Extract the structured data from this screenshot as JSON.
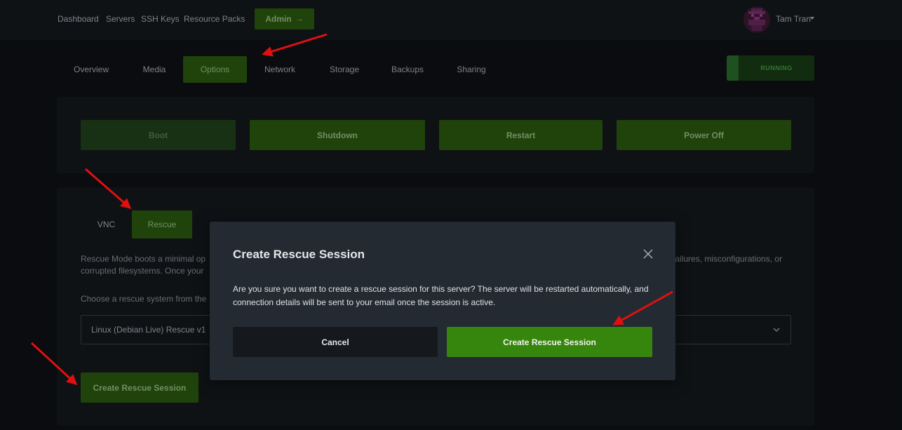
{
  "nav": {
    "dashboard": "Dashboard",
    "servers": "Servers",
    "ssh_keys": "SSH Keys",
    "resource_packs": "Resource Packs",
    "admin": "Admin",
    "admin_arrow": "→"
  },
  "user": {
    "name": "Tam Tran"
  },
  "tabs": [
    "Overview",
    "Media",
    "Options",
    "Network",
    "Storage",
    "Backups",
    "Sharing"
  ],
  "active_tab": "Options",
  "status": {
    "label": "RUNNING",
    "color": "#2a6b2b"
  },
  "power": {
    "boot": "Boot",
    "shutdown": "Shutdown",
    "restart": "Restart",
    "power_off": "Power Off"
  },
  "subtabs": {
    "vnc": "VNC",
    "rescue": "Rescue"
  },
  "rescue": {
    "desc_line1_left": "Rescue Mode boots a minimal op",
    "desc_line1_right": "failures, misconfigurations, or",
    "desc_line2": "corrupted filesystems. Once your",
    "choose_text": "Choose a rescue system from the",
    "selected_system": "Linux (Debian Live) Rescue v1",
    "create_button": "Create Rescue Session"
  },
  "modal": {
    "title": "Create Rescue Session",
    "body": "Are you sure you want to create a rescue session for this server? The server will be restarted automatically, and connection details will be sent to your email once the session is active.",
    "cancel": "Cancel",
    "confirm": "Create Rescue Session"
  },
  "colors": {
    "accent_green": "#2a5a0f",
    "confirm_green": "#36860d",
    "annotation_red": "#e01010"
  },
  "icons": {
    "close": "close-icon",
    "chevron": "chevron-down-icon",
    "arrow": "arrow-right-icon",
    "annotation": "annotation-arrow-icon"
  }
}
